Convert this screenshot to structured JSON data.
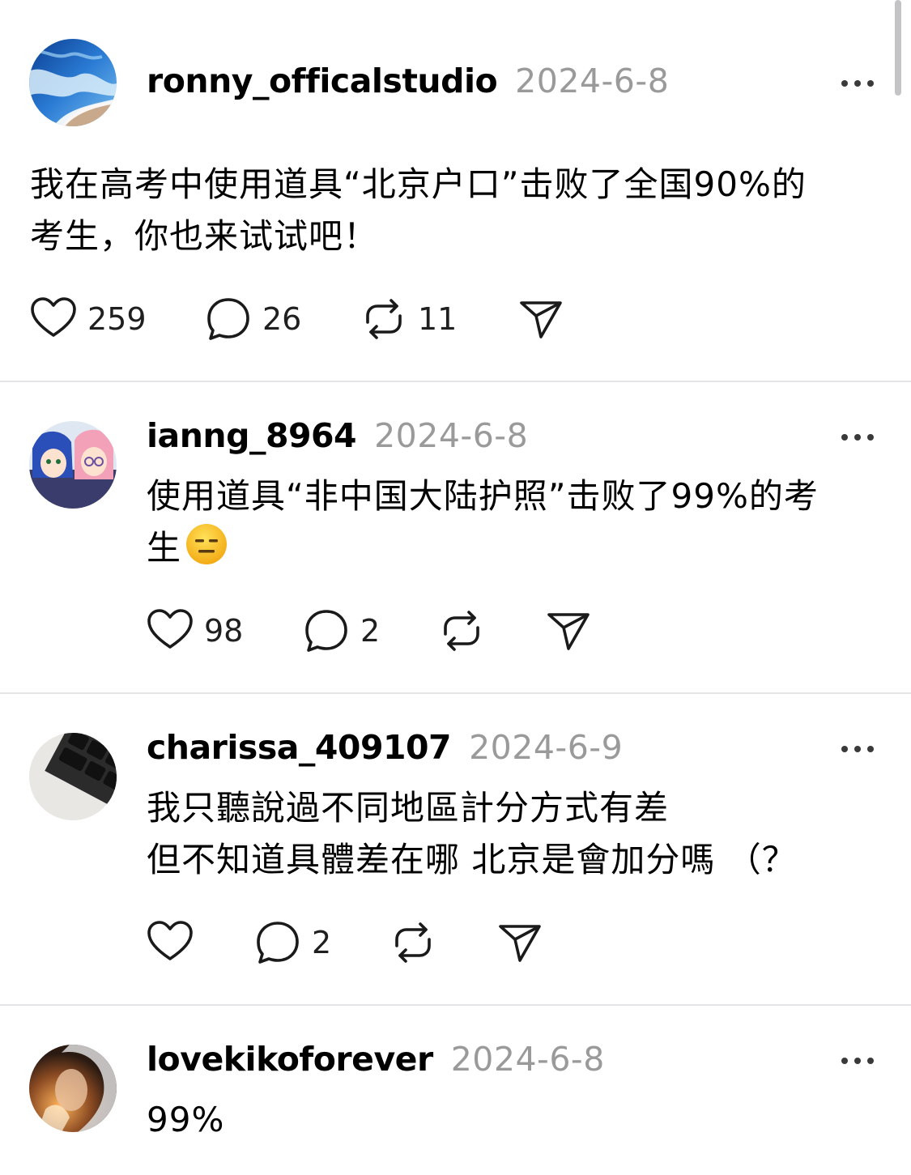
{
  "posts": [
    {
      "username": "ronny_officalstudio",
      "date": "2024-6-8",
      "text": "我在高考中使用道具“北京户口”击败了全国90%的\n考生，你也来试试吧！",
      "likes": "259",
      "replies": "26",
      "reposts": "11",
      "avatar": "ocean-wave-avatar"
    },
    {
      "username": "ianng_8964",
      "date": "2024-6-8",
      "text_line1": "使用道具“非中国大陆护照”击败了99%的考",
      "text_line2": "生",
      "emoji": "expressionless-face-emoji",
      "likes": "98",
      "replies": "2",
      "reposts": "",
      "avatar": "anime-characters-avatar"
    },
    {
      "username": "charissa_409107",
      "date": "2024-6-9",
      "text": "我只聽說過不同地區計分方式有差\n但不知道具體差在哪 北京是會加分嗎 （？",
      "likes": "",
      "replies": "2",
      "reposts": "",
      "avatar": "keyboard-keys-avatar"
    },
    {
      "username": "lovekikoforever",
      "date": "2024-6-8",
      "text": "99%",
      "avatar": "portrait-avatar"
    }
  ],
  "icons": {
    "like": "heart-icon",
    "reply": "comment-bubble-icon",
    "repost": "repost-arrows-icon",
    "share": "send-paper-plane-icon",
    "more": "more-dots-icon"
  },
  "colors": {
    "text": "#000000",
    "muted": "#9a9a9a",
    "divider": "#e5e5e7"
  }
}
